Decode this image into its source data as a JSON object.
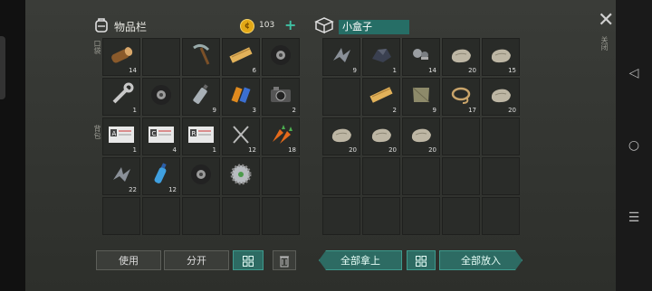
{
  "inventory": {
    "title": "物品栏",
    "coins": "103",
    "hotbar_label": "口袋",
    "backpack_label": "背包",
    "slots": [
      {
        "icon": "log-icon",
        "count": "14"
      },
      {
        "icon": "",
        "count": ""
      },
      {
        "icon": "pickaxe-icon",
        "count": ""
      },
      {
        "icon": "plank-icon",
        "count": "6"
      },
      {
        "icon": "tire-icon",
        "count": ""
      },
      {
        "icon": "wrench-icon",
        "count": "1"
      },
      {
        "icon": "tire-icon",
        "count": ""
      },
      {
        "icon": "spray-can-icon",
        "count": "9"
      },
      {
        "icon": "battery-icon",
        "count": "3"
      },
      {
        "icon": "camera-icon",
        "count": "2"
      },
      {
        "icon": "card-a-icon",
        "count": "1"
      },
      {
        "icon": "card-c-icon",
        "count": "4"
      },
      {
        "icon": "card-r-icon",
        "count": "1"
      },
      {
        "icon": "nails-icon",
        "count": "12"
      },
      {
        "icon": "carrot-icon",
        "count": "18"
      },
      {
        "icon": "scrap-icon",
        "count": "22"
      },
      {
        "icon": "water-bottle-icon",
        "count": "12"
      },
      {
        "icon": "tire-icon",
        "count": ""
      },
      {
        "icon": "saw-blade-icon",
        "count": ""
      },
      {
        "icon": "",
        "count": ""
      },
      {
        "icon": "",
        "count": ""
      },
      {
        "icon": "",
        "count": ""
      },
      {
        "icon": "",
        "count": ""
      },
      {
        "icon": "",
        "count": ""
      },
      {
        "icon": "",
        "count": ""
      }
    ],
    "buttons": {
      "use": "使用",
      "split": "分开"
    }
  },
  "container": {
    "title": "小盒子",
    "slots": [
      {
        "icon": "scrap-icon",
        "count": "9"
      },
      {
        "icon": "ore-icon",
        "count": "1"
      },
      {
        "icon": "bolts-icon",
        "count": "14"
      },
      {
        "icon": "stone-icon",
        "count": "20"
      },
      {
        "icon": "stone-icon",
        "count": "15"
      },
      {
        "icon": "",
        "count": ""
      },
      {
        "icon": "plank-icon",
        "count": "2"
      },
      {
        "icon": "cloth-icon",
        "count": "9"
      },
      {
        "icon": "rope-icon",
        "count": "17"
      },
      {
        "icon": "stone-icon",
        "count": "20"
      },
      {
        "icon": "stone-icon",
        "count": "20"
      },
      {
        "icon": "stone-icon",
        "count": "20"
      },
      {
        "icon": "stone-icon",
        "count": "20"
      },
      {
        "icon": "",
        "count": ""
      },
      {
        "icon": "",
        "count": ""
      },
      {
        "icon": "",
        "count": ""
      },
      {
        "icon": "",
        "count": ""
      },
      {
        "icon": "",
        "count": ""
      },
      {
        "icon": "",
        "count": ""
      },
      {
        "icon": "",
        "count": ""
      },
      {
        "icon": "",
        "count": ""
      },
      {
        "icon": "",
        "count": ""
      },
      {
        "icon": "",
        "count": ""
      },
      {
        "icon": "",
        "count": ""
      },
      {
        "icon": "",
        "count": ""
      }
    ],
    "buttons": {
      "take_all": "全部拿上",
      "put_all": "全部放入"
    }
  },
  "close_label": "关闭",
  "colors": {
    "accent": "#2d6b63",
    "coin": "#e3a816",
    "plus": "#3fc0a3"
  }
}
